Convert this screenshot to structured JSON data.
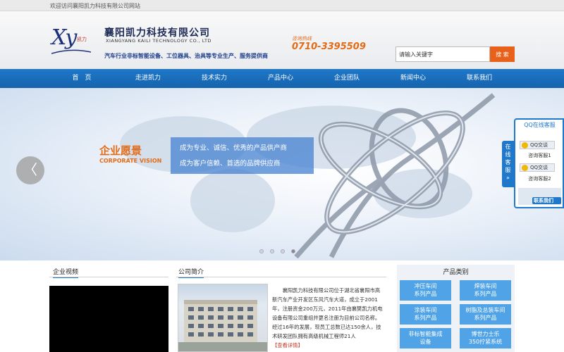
{
  "topbar": {
    "welcome": "欢迎访问襄阳凯力科技有限公司网站"
  },
  "header": {
    "logo_text": "Xy",
    "logo_sub": "凯力",
    "company_cn": "襄阳凯力科技有限公司",
    "company_en": "XIANGYANG KAILI TECHNOLOGY CO., LTD",
    "slogan": "汽车行业非标智能设备、工位器具、治具等专业生产、服务提供商",
    "hotline_label": "咨询热线",
    "hotline_number": "0710-3395509"
  },
  "search": {
    "placeholder": "请输入关键字",
    "button": "搜 索"
  },
  "nav": {
    "items": [
      "首　页",
      "走进凯力",
      "技术实力",
      "产品中心",
      "企业团队",
      "新闻中心",
      "联系我们"
    ]
  },
  "banner": {
    "vision_cn": "企业愿景",
    "vision_en": "CORPORATE VISION",
    "line1": "成为专业、诚信、优秀的产品供产商",
    "line2": "成为客户信赖、首选的品牌供应商",
    "prev": "〈",
    "slides": 4,
    "active_slide": 3
  },
  "qq": {
    "tab": "在线客服",
    "tab_arrow": "»",
    "title": "QQ在线客服",
    "btn": "QQ交谈",
    "service1": "咨询客服1",
    "service2": "咨询客服2",
    "contact": "联系我们"
  },
  "sections": {
    "video": "企业视频",
    "intro": "公司简介",
    "products": "产品类别"
  },
  "intro": {
    "text": "襄阳凯力科技有限公司位于湖北省襄阳市高新汽车产业开发区东风汽车大道，成立于2001年，注册资金200万元，2011年由襄樊凯力机电设备有限公司重组并更名注册为目前公司名称。经过16年的发展，现员工总数已达150余人，技术研发团队拥有高级机械工程师21人",
    "more": "【查看详情】"
  },
  "categories": [
    {
      "line1": "冲压车间",
      "line2": "系列产品"
    },
    {
      "line1": "焊装车间",
      "line2": "系列产品"
    },
    {
      "line1": "涂装车间",
      "line2": "系列产品"
    },
    {
      "line1": "树脂及总装车间",
      "line2": "系列产品"
    },
    {
      "line1": "非标智能集成",
      "line2": "设备"
    },
    {
      "line1": "博世力士乐",
      "line2": "350拧紧系统"
    }
  ],
  "colors": {
    "primary": "#1f78c9",
    "accent": "#e36b16",
    "category": "#4fa3e6"
  }
}
